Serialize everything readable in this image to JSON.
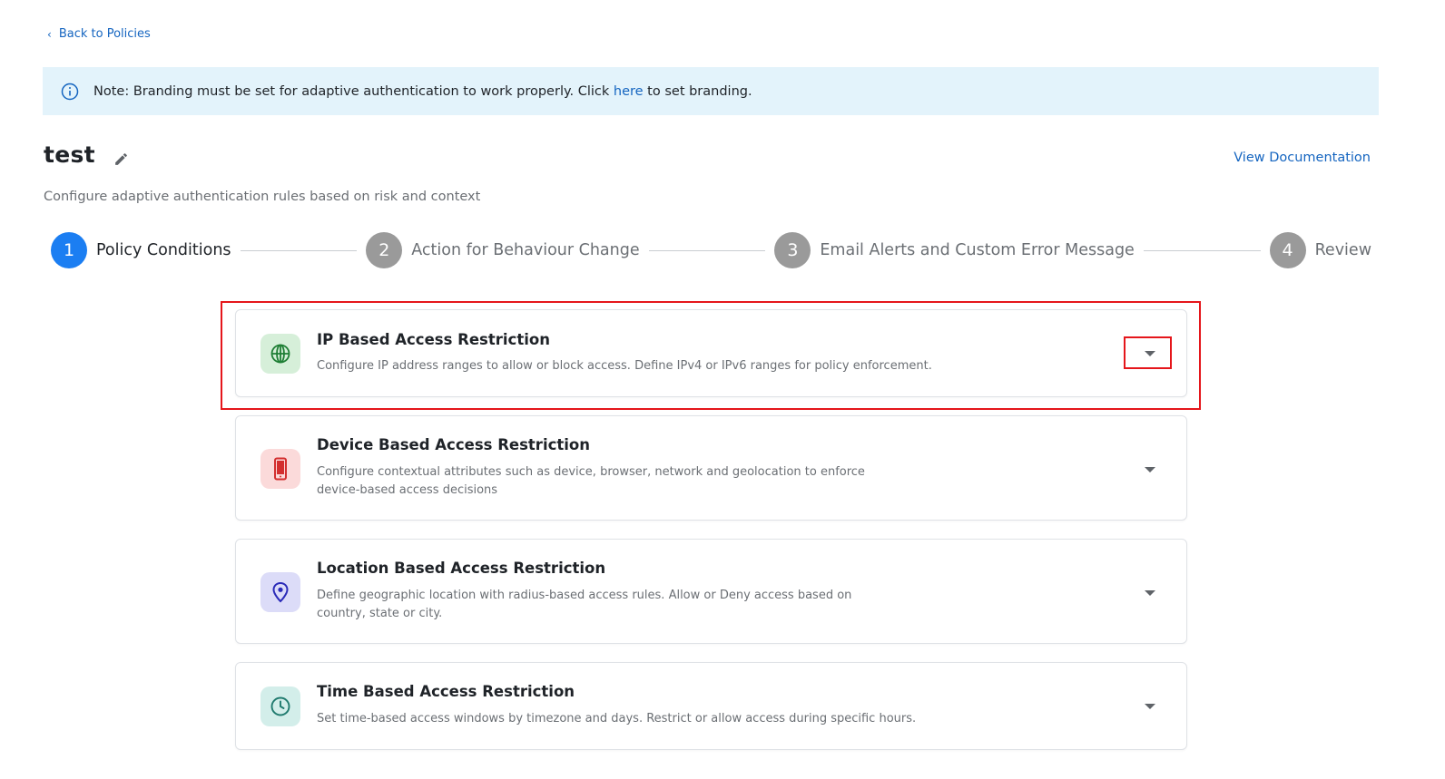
{
  "nav": {
    "back_label": "Back to Policies"
  },
  "note": {
    "prefix": "Note: Branding must be set for adaptive authentication to work properly. Click ",
    "link": "here",
    "suffix": " to set branding."
  },
  "header": {
    "title": "test",
    "view_doc": "View Documentation",
    "subtitle": "Configure adaptive authentication rules based on risk and context"
  },
  "steps": [
    {
      "number": "1",
      "label": "Policy Conditions",
      "active": true
    },
    {
      "number": "2",
      "label": "Action for Behaviour Change",
      "active": false
    },
    {
      "number": "3",
      "label": "Email Alerts and Custom Error Message",
      "active": false
    },
    {
      "number": "4",
      "label": "Review",
      "active": false
    }
  ],
  "cards": [
    {
      "title": "IP Based Access Restriction",
      "desc": "Configure IP address ranges to allow or block access. Define IPv4 or IPv6 ranges for policy enforcement.",
      "icon": "globe-icon"
    },
    {
      "title": "Device Based Access Restriction",
      "desc": "Configure contextual attributes such as device, browser, network and geolocation to enforce device-based access decisions",
      "icon": "mobile-phone-icon"
    },
    {
      "title": "Location Based Access Restriction",
      "desc": "Define geographic location with radius-based access rules. Allow or Deny access based on country, state or city.",
      "icon": "location-pin-icon"
    },
    {
      "title": "Time Based Access Restriction",
      "desc": "Set time-based access windows by timezone and days. Restrict or allow access during specific hours.",
      "icon": "clock-icon"
    }
  ],
  "colors": {
    "accent": "#1b7ef2",
    "link": "#1565c0",
    "note_bg": "#e3f3fb",
    "highlight": "#e5161b"
  }
}
